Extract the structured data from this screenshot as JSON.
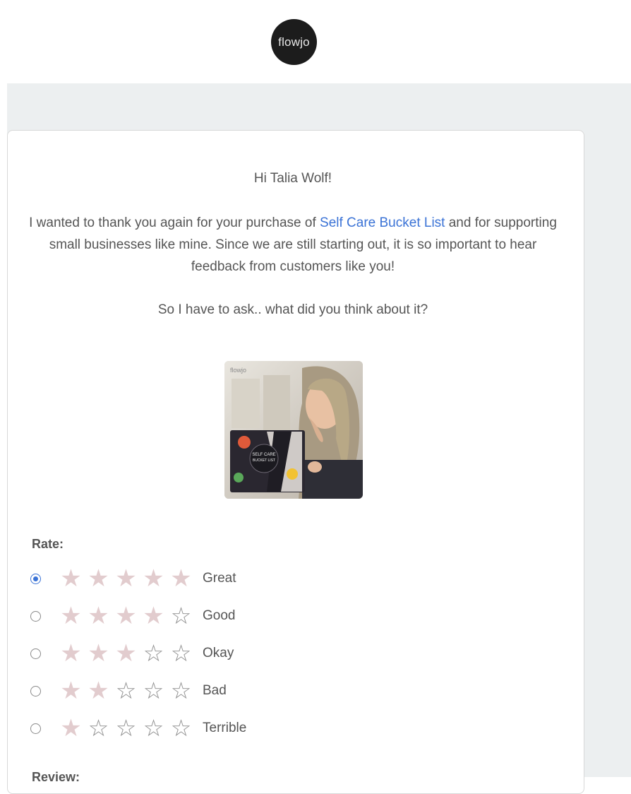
{
  "brand": {
    "logo_text": "flowjo",
    "logo_bg": "#1c1c1c"
  },
  "email": {
    "greeting": "Hi Talia Wolf!",
    "intro_before_link": "I wanted to thank you again for your purchase of ",
    "product_link": "Self Care Bucket List",
    "intro_after_link": " and for supporting small businesses like mine. Since we are still starting out, it is so important to hear feedback from customers like you!",
    "ask": "So I have to ask.. what did you think about it?",
    "product_image": {
      "watermark": "flowjo",
      "box_text_line1": "SELF CARE",
      "box_text_line2": "BUCKET LIST"
    }
  },
  "rating": {
    "label": "Rate:",
    "options": [
      {
        "label": "Great",
        "stars": 5,
        "selected": true
      },
      {
        "label": "Good",
        "stars": 4,
        "selected": false
      },
      {
        "label": "Okay",
        "stars": 3,
        "selected": false
      },
      {
        "label": "Bad",
        "stars": 2,
        "selected": false
      },
      {
        "label": "Terrible",
        "stars": 1,
        "selected": false
      }
    ],
    "max_stars": 5,
    "filled_star_color": "#e2ccce",
    "empty_star_color": "#909090",
    "radio_accent": "#3b73d6"
  },
  "review": {
    "label": "Review:"
  },
  "colors": {
    "link": "#3b73d6",
    "page_band": "#eceff0",
    "text": "#555555"
  }
}
